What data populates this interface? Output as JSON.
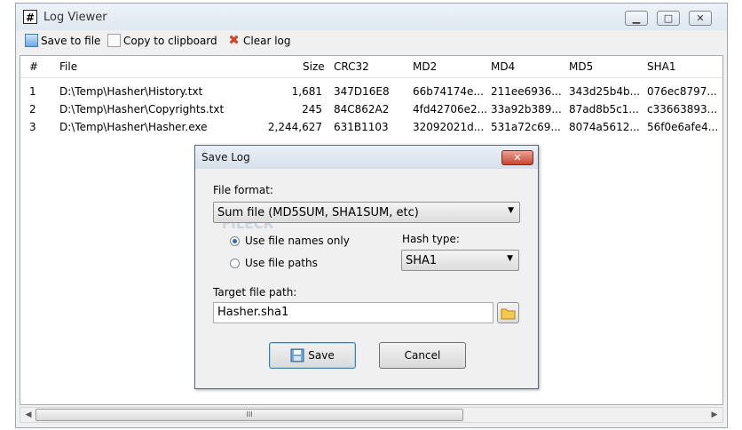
{
  "window": {
    "title": "Log Viewer",
    "app_icon": "#",
    "controls": [
      "minimize",
      "maximize",
      "close"
    ]
  },
  "toolbar": {
    "save_to_file": "Save to file",
    "copy_to_clipboard": "Copy to clipboard",
    "clear_log": "Clear log"
  },
  "table": {
    "headers": [
      "#",
      "File",
      "Size",
      "CRC32",
      "MD2",
      "MD4",
      "MD5",
      "SHA1"
    ],
    "rows": [
      {
        "num": "1",
        "file": "D:\\Temp\\Hasher\\History.txt",
        "size": "1,681",
        "crc32": "347D16E8",
        "md2": "66b74174e...",
        "md4": "211ee6936...",
        "md5": "343d25b4b...",
        "sha1": "076ec8797..."
      },
      {
        "num": "2",
        "file": "D:\\Temp\\Hasher\\Copyrights.txt",
        "size": "245",
        "crc32": "84C862A2",
        "md2": "4fd42706e2...",
        "md4": "33a92b389...",
        "md5": "87ad8b5c1...",
        "sha1": "c33663893..."
      },
      {
        "num": "3",
        "file": "D:\\Temp\\Hasher\\Hasher.exe",
        "size": "2,244,627",
        "crc32": "631B1103",
        "md2": "32092021d...",
        "md4": "531a72c69...",
        "md5": "8074a5612...",
        "sha1": "56f0e6afe4..."
      }
    ]
  },
  "scrollbar": {
    "thumb_grip": "III"
  },
  "dialog": {
    "title": "Save Log",
    "close_glyph": "✕",
    "file_format_label": "File format:",
    "file_format_value": "Sum file (MD5SUM, SHA1SUM, etc)",
    "radio_names_only": "Use file names only",
    "radio_file_paths": "Use file paths",
    "hash_type_label": "Hash type:",
    "hash_type_value": "SHA1",
    "target_label": "Target file path:",
    "target_value": "Hasher.sha1",
    "save_button": "Save",
    "cancel_button": "Cancel",
    "watermark": "FILECR"
  },
  "colors": {
    "accent": "#2e6fb4",
    "close_red": "#c8452f",
    "folder": "#f2c94c"
  }
}
